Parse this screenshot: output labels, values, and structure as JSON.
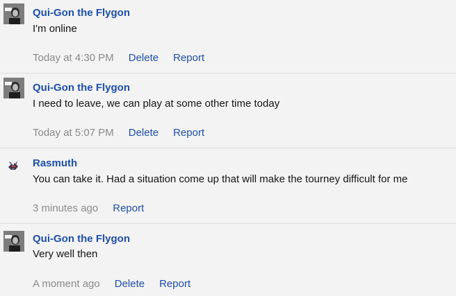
{
  "messages": [
    {
      "username": "Qui-Gon the Flygon",
      "text": "I'm online",
      "time": "Today at 4:30 PM",
      "delete_label": "Delete",
      "report_label": "Report"
    },
    {
      "username": "Qui-Gon the Flygon",
      "text": "I need to leave, we can play at some other time today",
      "time": "Today at 5:07 PM",
      "delete_label": "Delete",
      "report_label": "Report"
    },
    {
      "username": "Rasmuth",
      "text": "You can take it. Had a situation come up that will make the tourney difficult for me",
      "time": "3 minutes ago",
      "report_label": "Report"
    },
    {
      "username": "Qui-Gon the Flygon",
      "text": "Very well then",
      "time": "A moment ago",
      "delete_label": "Delete",
      "report_label": "Report"
    }
  ],
  "colors": {
    "link": "#1d4fa8",
    "muted": "#8a8a8a",
    "text": "#141414",
    "background": "#f3f3f3"
  }
}
